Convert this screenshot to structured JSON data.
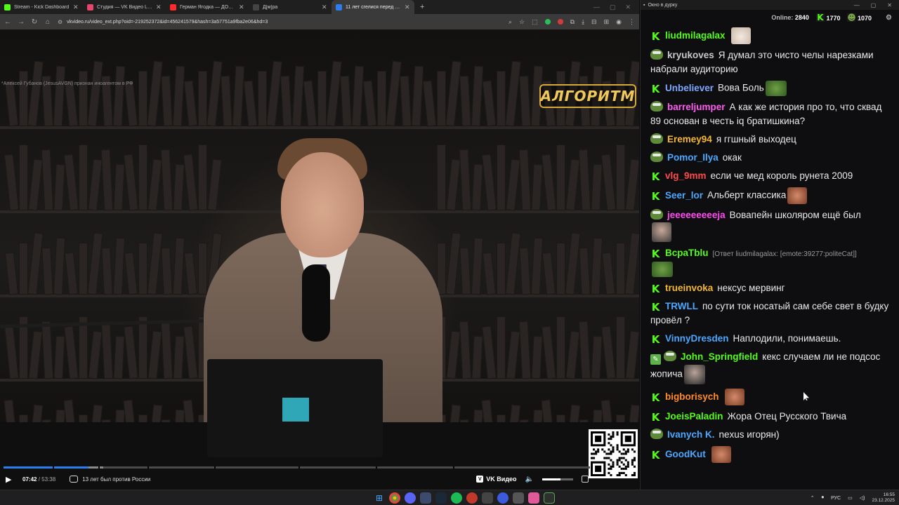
{
  "browser": {
    "tabs": [
      {
        "title": "Stream - Kick Dashboard",
        "color": "#53fc18",
        "active": false
      },
      {
        "title": "Студия — VK Видео Live",
        "color": "#e6466e",
        "active": false
      },
      {
        "title": "Герман Ягодка — ДОМ 2 и ж",
        "color": "#ff2a2a",
        "active": false
      },
      {
        "title": "Д[м]ра",
        "color": "#444444",
        "active": false
      },
      {
        "title": "11 лет сгелися перед Украин",
        "color": "#2c7ef0",
        "active": true
      }
    ],
    "url": "vkvideo.ru/video_ext.php?oid=-219252372&id=456241579&hash=3a57751a9fba2e06&hd=3"
  },
  "video": {
    "watermark": "*Алексей Губанов (JesusAVGN) признан иноагентом в РФ",
    "logo": "АЛГОРИТМ",
    "time_current": "07:42",
    "time_duration": "53:38",
    "chapter": "13 лет был против России",
    "brand": "VK Видео",
    "progress_played": 0.145,
    "progress_buffered": 0.17,
    "volume_level": 0.6
  },
  "chat": {
    "window_title": "Окно в дурку",
    "online_label": "Online:",
    "online_count": "2840",
    "kick_count": "1770",
    "frog_count": "1070",
    "messages": [
      {
        "user": "liudmilagalax",
        "color": "#53fc18",
        "badge": "kick",
        "text": "",
        "emote": "cat"
      },
      {
        "user": "kryukoves",
        "color": "#c9c9c9",
        "badge": "frog",
        "text": "Я думал это чисто челы нарезками набрали аудиторию"
      },
      {
        "user": "Unbeliever",
        "color": "#7ba7ff",
        "badge": "kick",
        "text": "Вова Боль",
        "emote": "frog2"
      },
      {
        "user": "barreljumper",
        "color": "#ff5cf0",
        "badge": "frog",
        "text": "А как же история про то, что сквад 89 основан в честь iq братишкина?"
      },
      {
        "user": "Eremey94",
        "color": "#f5b82e",
        "badge": "frog",
        "text": "я ггшный выходец"
      },
      {
        "user": "Pomor_Ilya",
        "color": "#4aa8ff",
        "badge": "frog",
        "text": "окак"
      },
      {
        "user": "vlg_9mm",
        "color": "#ff4a4a",
        "badge": "kick",
        "text": "если че мед король рунета 2009"
      },
      {
        "user": "Seer_lor",
        "color": "#4aa8ff",
        "badge": "kick",
        "text": "Альберт классика",
        "emote": "fatface"
      },
      {
        "user": "jeeeeeeeeeja",
        "color": "#ff4af0",
        "badge": "frog",
        "text": "Вовапейн школяром ещё был",
        "emote": "guy"
      },
      {
        "user": "BcpaTblu",
        "color": "#53fc18",
        "badge": "kick",
        "text": "",
        "reply": "[Ответ liudmilagalax: [emote:39277:politeCat]]",
        "emote": "frog2"
      },
      {
        "user": "trueinvoka",
        "color": "#f5b82e",
        "badge": "kick",
        "text": "нексус мервинг"
      },
      {
        "user": "TRWLL",
        "color": "#4aa8ff",
        "badge": "kick",
        "text": "по сути ток носатый сам себе свет в будку провёл ?"
      },
      {
        "user": "VinnyDresden",
        "color": "#4aa8ff",
        "badge": "kick",
        "text": "Наплодили, понимаешь."
      },
      {
        "user": "John_Springfield",
        "color": "#53fc18",
        "badge": "pen",
        "text": "кекс случаем ли не подсос жопича",
        "emote": "dark"
      },
      {
        "user": "bigborisych",
        "color": "#ff8a2a",
        "badge": "kick",
        "text": "",
        "emote": "fatface"
      },
      {
        "user": "JoeisPaladin",
        "color": "#53fc18",
        "badge": "kick",
        "text": "Жора Отец Русского Твича"
      },
      {
        "user": "Ivanych K.",
        "color": "#4aa8ff",
        "badge": "frog",
        "text": "nexus игорян)"
      },
      {
        "user": "GoodKut",
        "color": "#4aa8ff",
        "badge": "kick",
        "text": "",
        "emote": "fatface"
      }
    ]
  },
  "taskbar": {
    "lang": "РУС",
    "time": "16:55",
    "date": "23.12.2025"
  }
}
